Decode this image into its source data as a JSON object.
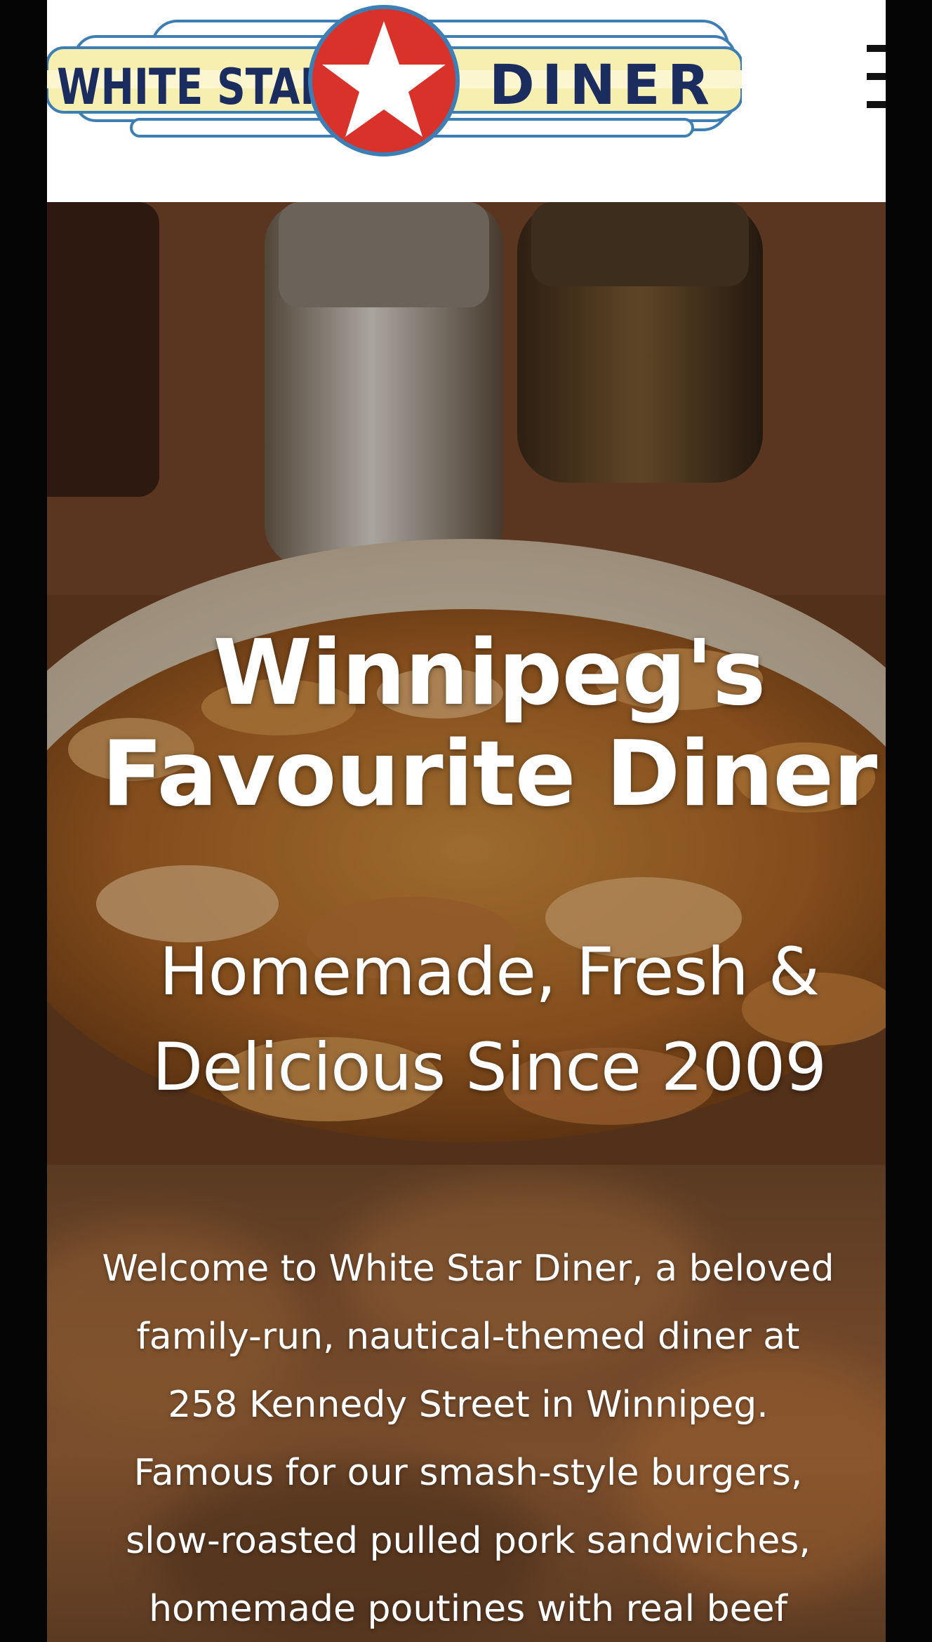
{
  "header": {
    "logo": {
      "left_text": "WHITE STAR",
      "right_text": "DINER"
    },
    "menu_icon": "hamburger-menu-icon"
  },
  "hero": {
    "title_line1": "Winnipeg's",
    "title_line2": "Favourite Diner",
    "subtitle_line1": "Homemade, Fresh &",
    "subtitle_line2": "Delicious Since 2009"
  },
  "intro": {
    "lines": [
      "Welcome to White Star Diner, a beloved",
      "family-run, nautical-themed diner at",
      "258 Kennedy Street in Winnipeg.",
      "Famous for our smash-style burgers,",
      "slow-roasted pulled pork sandwiches,",
      "homemade poutines with real beef"
    ]
  },
  "colors": {
    "logo_red": "#d8322a",
    "logo_navy": "#1b2c5e",
    "logo_yellow": "#f7efb0",
    "logo_blue_outline": "#3d7fb5"
  }
}
